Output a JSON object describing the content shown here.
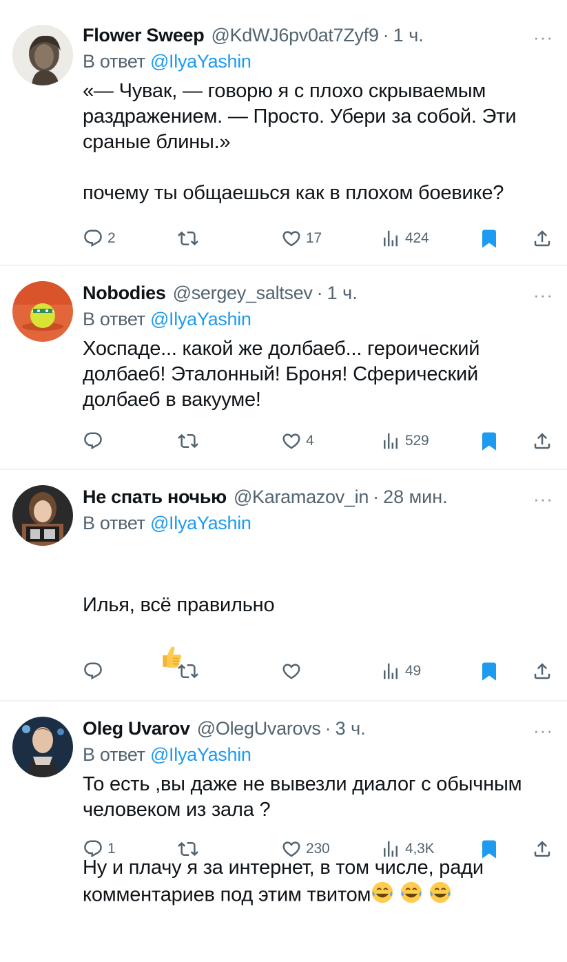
{
  "tweets": [
    {
      "name": "Flower Sweep",
      "handle": "@KdWJ6pv0at7Zyf9",
      "dot": "·",
      "time": "1 ч.",
      "reply_prefix": "В ответ",
      "reply_mention": "@IlyaYashin",
      "text": "«— Чувак, — говорю я с плохо скрываемым раздражением. — Просто. Убери за собой. Эти сраные блины.»\n\nпочему ты общаешься как в плохом боевике?",
      "replies": "2",
      "retweets": "",
      "likes": "17",
      "views": "424"
    },
    {
      "name": "Nobodies",
      "handle": "@sergey_saltsev",
      "dot": "·",
      "time": "1 ч.",
      "reply_prefix": "В ответ",
      "reply_mention": "@IlyaYashin",
      "text": "Хоспаде... какой же долбаеб... героический долбаеб! Эталонный! Броня! Сферический долбаеб в вакууме!",
      "replies": "",
      "retweets": "",
      "likes": "4",
      "views": "529"
    },
    {
      "name": "Не спать ночью",
      "handle": "@Karamazov_in",
      "dot": "·",
      "time": "28 мин.",
      "reply_prefix": "В ответ",
      "reply_mention": "@IlyaYashin",
      "text_line1": "Илья, всё правильно",
      "text_rest": "Ну и плачу я за интернет, в том числе, ради комментариев под этим твитом",
      "replies": "",
      "retweets": "",
      "likes": "",
      "views": "49"
    },
    {
      "name": "Oleg Uvarov",
      "handle": "@OlegUvarovs",
      "dot": "·",
      "time": "3 ч.",
      "reply_prefix": "В ответ",
      "reply_mention": "@IlyaYashin",
      "text": "То есть ,вы даже не вывезли диалог с обычным человеком из зала ?",
      "replies": "1",
      "retweets": "",
      "likes": "230",
      "views": "4,3K"
    }
  ],
  "more_glyph": "···",
  "icons": {
    "reply": "reply-icon",
    "retweet": "retweet-icon",
    "like": "heart-icon",
    "views": "views-icon",
    "bookmark": "bookmark-icon",
    "share": "share-icon",
    "thumbs_up": "thumbs-up-emoji",
    "laugh": "tears-of-joy-emoji"
  },
  "colors": {
    "text": "#0f1419",
    "muted": "#536471",
    "link": "#1d9bf0",
    "divider": "#eff3f4"
  }
}
